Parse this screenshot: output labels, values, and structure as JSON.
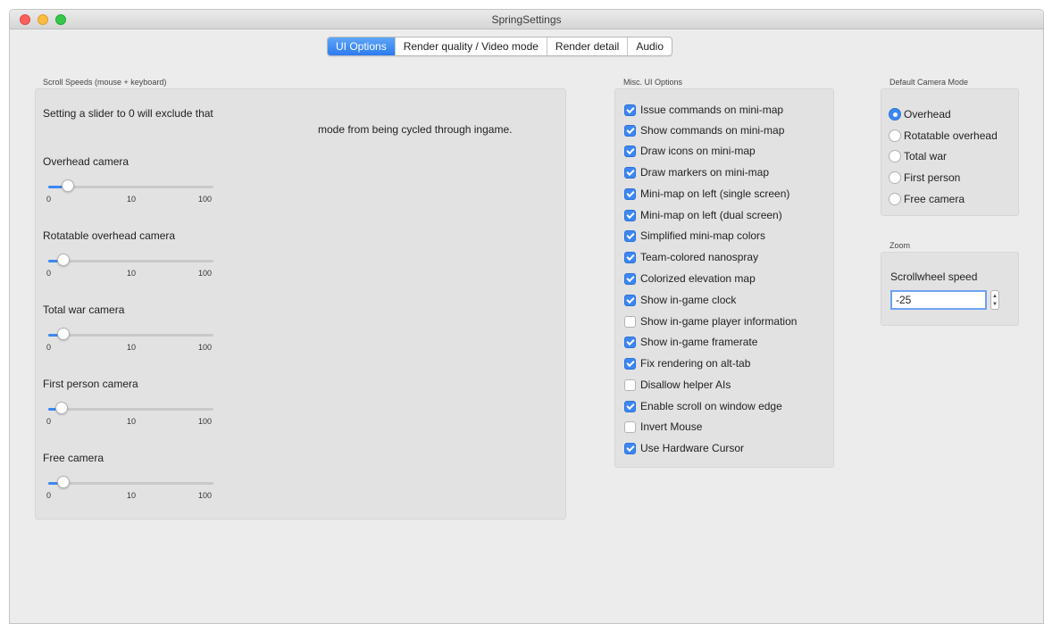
{
  "window": {
    "title": "SpringSettings"
  },
  "tabs": [
    {
      "label": "UI Options",
      "active": true
    },
    {
      "label": "Render quality / Video mode",
      "active": false
    },
    {
      "label": "Render detail",
      "active": false
    },
    {
      "label": "Audio",
      "active": false
    }
  ],
  "scroll_speeds": {
    "group_title": "Scroll Speeds (mouse + keyboard)",
    "intro_line1": "Setting a slider to 0 will exclude that",
    "intro_line2": "mode from being cycled through ingame.",
    "sliders": [
      {
        "label": "Overhead camera",
        "value": 10,
        "tick_labels": [
          "0",
          "10",
          "100"
        ]
      },
      {
        "label": "Rotatable overhead camera",
        "value": 10,
        "tick_labels": [
          "0",
          "10",
          "100"
        ]
      },
      {
        "label": "Total war camera",
        "value": 10,
        "tick_labels": [
          "0",
          "10",
          "100"
        ]
      },
      {
        "label": "First person camera",
        "value": 10,
        "tick_labels": [
          "0",
          "10",
          "100"
        ]
      },
      {
        "label": "Free camera",
        "value": 10,
        "tick_labels": [
          "0",
          "10",
          "100"
        ]
      }
    ]
  },
  "misc_ui": {
    "group_title": "Misc. UI Options",
    "options": [
      {
        "label": "Issue commands on mini-map",
        "checked": true
      },
      {
        "label": "Show commands on mini-map",
        "checked": true
      },
      {
        "label": "Draw icons on mini-map",
        "checked": true
      },
      {
        "label": "Draw markers on mini-map",
        "checked": true
      },
      {
        "label": "Mini-map on left (single screen)",
        "checked": true
      },
      {
        "label": "Mini-map on left (dual screen)",
        "checked": true
      },
      {
        "label": "Simplified mini-map colors",
        "checked": true
      },
      {
        "label": "Team-colored nanospray",
        "checked": true
      },
      {
        "label": "Colorized elevation map",
        "checked": true
      },
      {
        "label": "Show in-game clock",
        "checked": true
      },
      {
        "label": "Show in-game player information",
        "checked": false
      },
      {
        "label": "Show in-game framerate",
        "checked": true
      },
      {
        "label": "Fix rendering on alt-tab",
        "checked": true
      },
      {
        "label": "Disallow helper AIs",
        "checked": false
      },
      {
        "label": "Enable scroll on window edge",
        "checked": true
      },
      {
        "label": "Invert Mouse",
        "checked": false
      },
      {
        "label": "Use Hardware Cursor",
        "checked": true
      }
    ]
  },
  "camera_mode": {
    "group_title": "Default Camera Mode",
    "options": [
      {
        "label": "Overhead",
        "selected": true
      },
      {
        "label": "Rotatable overhead",
        "selected": false
      },
      {
        "label": "Total war",
        "selected": false
      },
      {
        "label": "First person",
        "selected": false
      },
      {
        "label": "Free camera",
        "selected": false
      }
    ]
  },
  "zoom": {
    "group_title": "Zoom",
    "scrollwheel_label": "Scrollwheel speed",
    "scrollwheel_value": "-25"
  }
}
